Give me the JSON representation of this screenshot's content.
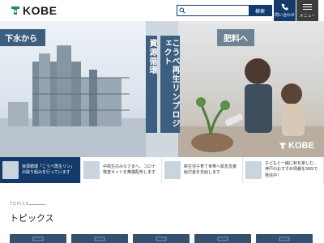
{
  "header": {
    "logo_text": "KOBE",
    "search_placeholder": "",
    "search_button": "検索",
    "contact_label": "問い合わせ",
    "menu_label": "メニュー"
  },
  "hero": {
    "tag_left": "下水から",
    "tag_right": "肥料へ",
    "vertical_text_1": "資源循環",
    "vertical_text_2": "こうべ再生リンプロジェクト",
    "brand": "KOBE"
  },
  "news": [
    {
      "text": "資源循環「こうべ再生リン」の取り組みを行っています",
      "active": true
    },
    {
      "text": "中高生のみなさまへ、コロナ検査キットを無償配布します",
      "active": false
    },
    {
      "text": "新生児子育て世帯へ緊急支援給付金を支給します",
      "active": false
    },
    {
      "text": "子どもと一緒に秋を楽しむ、神戸のおすすめ情報をSNSで発信中！",
      "active": false
    }
  ],
  "topics": {
    "label": "TOPICS",
    "title": "トピックス"
  },
  "colors": {
    "primary": "#123a6b",
    "menu": "#3c3c3c",
    "tag": "#3c5f7f"
  }
}
